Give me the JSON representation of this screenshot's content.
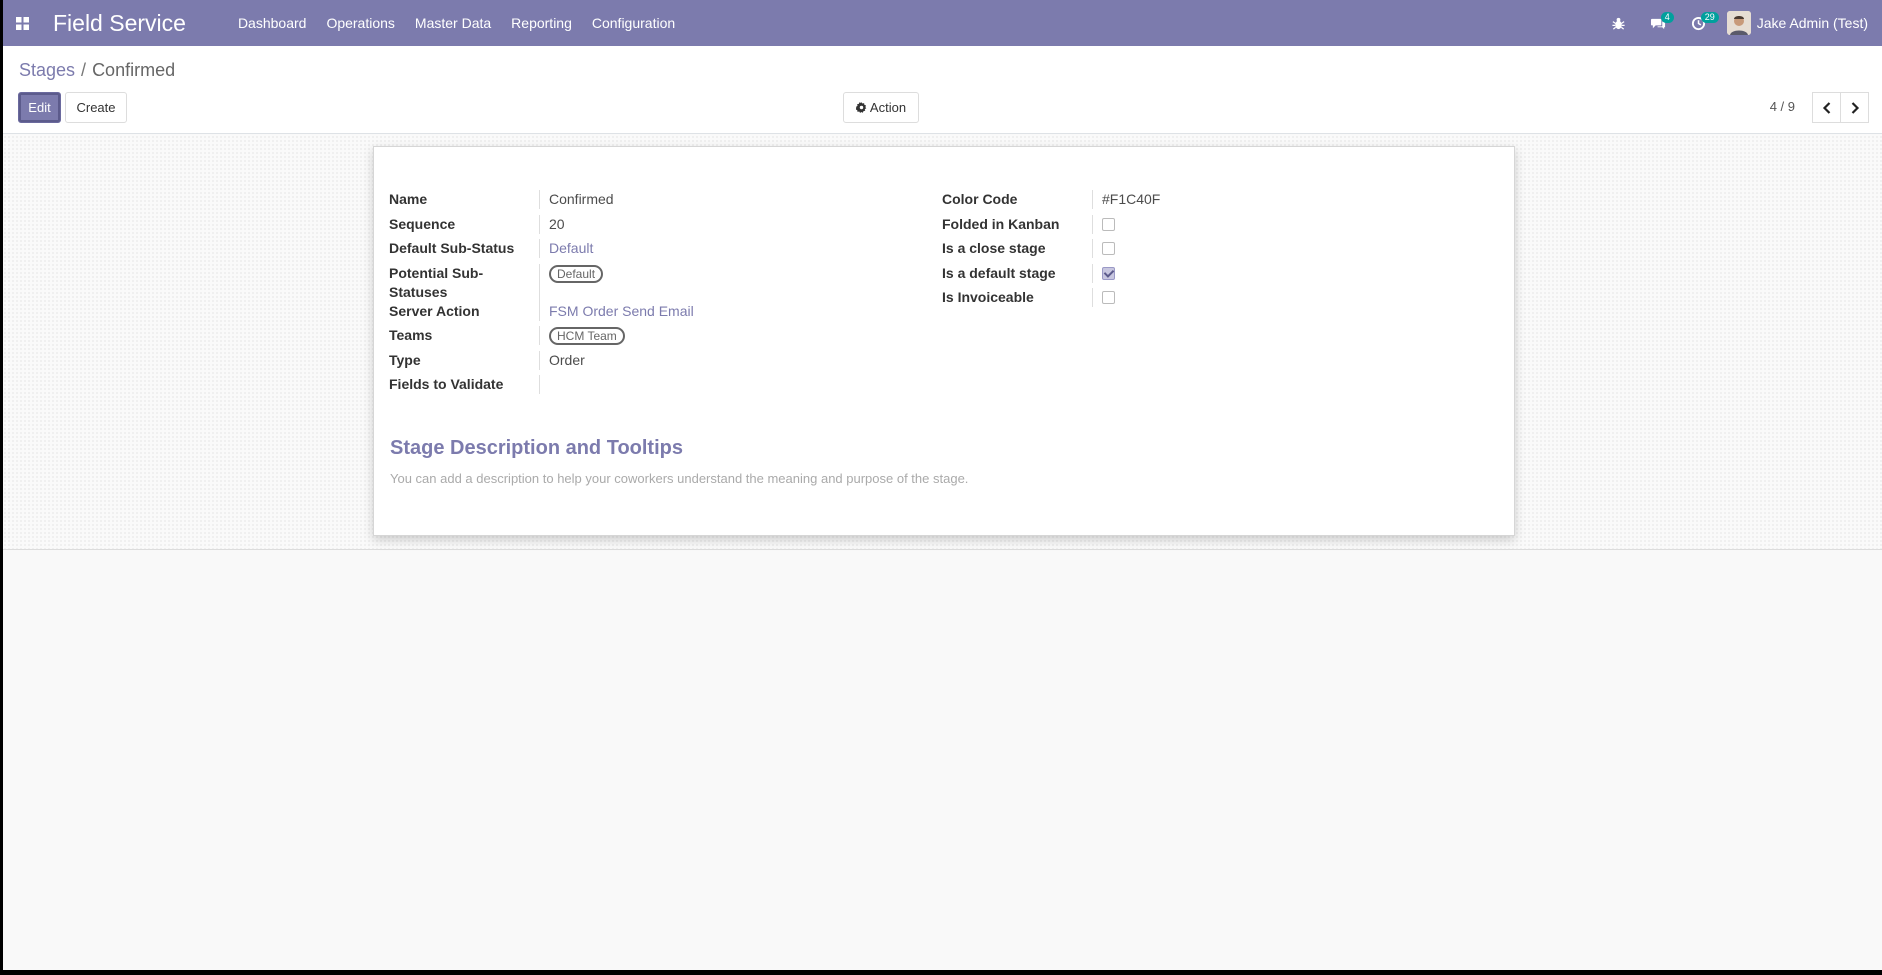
{
  "navbar": {
    "brand": "Field Service",
    "menu": [
      "Dashboard",
      "Operations",
      "Master Data",
      "Reporting",
      "Configuration"
    ],
    "messages_count": "4",
    "activities_count": "29",
    "user_name": "Jake Admin (Test)"
  },
  "breadcrumb": {
    "parent": "Stages",
    "separator": "/",
    "current": "Confirmed"
  },
  "buttons": {
    "edit": "Edit",
    "create": "Create",
    "action": "Action"
  },
  "pager": {
    "value": "4 / 9"
  },
  "form": {
    "left": [
      {
        "label": "Name",
        "value": "Confirmed"
      },
      {
        "label": "Sequence",
        "value": "20"
      },
      {
        "label": "Default Sub-Status",
        "value": "Default"
      },
      {
        "label": "Potential Sub-Statuses",
        "value": "Default"
      },
      {
        "label": "Server Action",
        "value": "FSM Order Send Email"
      },
      {
        "label": "Teams",
        "value": "HCM Team"
      },
      {
        "label": "Type",
        "value": "Order"
      },
      {
        "label": "Fields to Validate",
        "value": ""
      }
    ],
    "right": [
      {
        "label": "Color Code",
        "value": "#F1C40F"
      },
      {
        "label": "Folded in Kanban",
        "checked": false
      },
      {
        "label": "Is a close stage",
        "checked": false
      },
      {
        "label": "Is a default stage",
        "checked": true
      },
      {
        "label": "Is Invoiceable",
        "checked": false
      }
    ],
    "section_title": "Stage Description and Tooltips",
    "section_placeholder": "You can add a description to help your coworkers understand the meaning and purpose of the stage."
  },
  "colors": {
    "brand": "#7c7bad",
    "badge": "#00a09d"
  }
}
